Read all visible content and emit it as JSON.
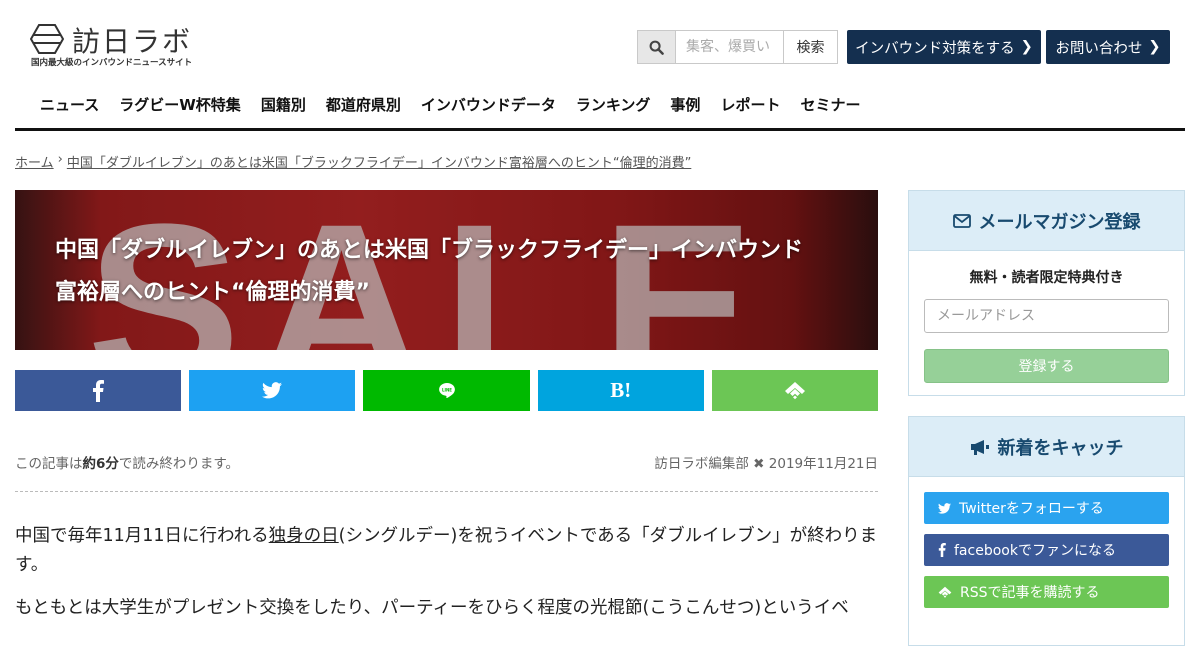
{
  "header": {
    "logo_text": "訪日ラボ",
    "logo_tagline": "国内最大級のインバウンドニュースサイト",
    "search_placeholder": "集客、爆買い",
    "search_button": "検索",
    "cta_inbound": "インバウンド対策をする",
    "cta_contact": "お問い合わせ"
  },
  "nav": [
    "ニュース",
    "ラグビーW杯特集",
    "国籍別",
    "都道府県別",
    "インバウンドデータ",
    "ランキング",
    "事例",
    "レポート",
    "セミナー"
  ],
  "breadcrumb": {
    "home": "ホーム",
    "current": "中国「ダブルイレブン」のあとは米国「ブラックフライデー」インバウンド富裕層へのヒント“倫理的消費”"
  },
  "article": {
    "hero_bg_text": "SALE",
    "title_line1": "中国「ダブルイレブン」のあとは米国「ブラックフライデー」インバウンド",
    "title_line2": "富裕層へのヒント“倫理的消費”",
    "reading_prefix": "この記事は",
    "reading_time": "約6分",
    "reading_suffix": "で読み終わります。",
    "author": "訪日ラボ編集部",
    "date": "2019年11月21日",
    "p1_before": "中国で毎年11月11日に行われる",
    "p1_link": "独身の日",
    "p1_after": "(シングルデー)を祝うイベントである「ダブルイレブン」が終わります。",
    "p2": "もともとは大学生がプレゼント交換をしたり、パーティーをひらく程度の光棍節(こうこんせつ)というイベ"
  },
  "share": {
    "hatena_label": "B!"
  },
  "sidebar": {
    "mail_title": "メールマガジン登録",
    "mail_sub": "無料・読者限定特典付き",
    "mail_placeholder": "メールアドレス",
    "mail_button": "登録する",
    "catch_title": "新着をキャッチ",
    "twitter": "Twitterをフォローする",
    "facebook": "facebookでファンになる",
    "rss": "RSSで記事を購読する"
  }
}
